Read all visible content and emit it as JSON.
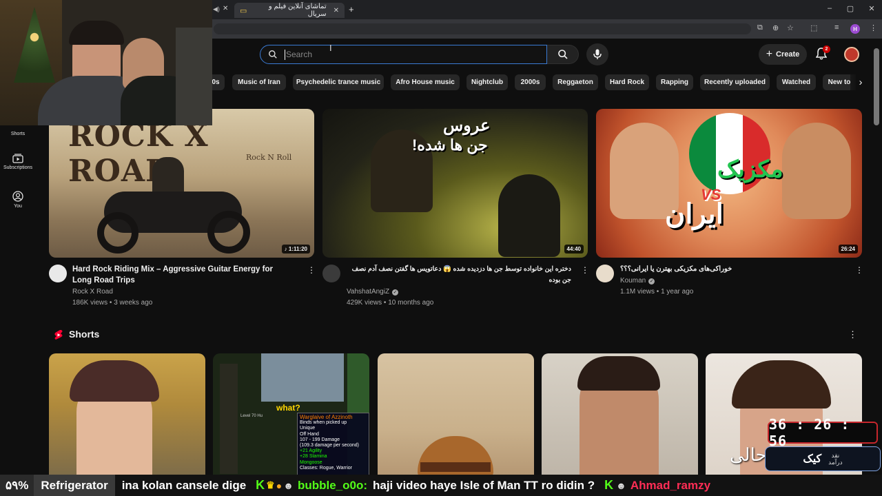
{
  "browser": {
    "tab_title": "تماشای آنلاین فیلم و سریال",
    "new_tab_symbol": "+",
    "window_controls": [
      "–",
      "▢",
      "✕"
    ],
    "profile_letter": "H"
  },
  "header": {
    "search_placeholder": "Search",
    "create_label": "Create",
    "notification_count": "2"
  },
  "chips": [
    "0s",
    "Music of Iran",
    "Psychedelic trance music",
    "Afro House music",
    "Nightclub",
    "2000s",
    "Reggaeton",
    "Hard Rock",
    "Rapping",
    "Recently uploaded",
    "Watched",
    "New to"
  ],
  "sidebar": {
    "items": [
      {
        "label": "Shorts",
        "icon": "shorts-icon"
      },
      {
        "label": "Subscriptions",
        "icon": "subscriptions-icon"
      },
      {
        "label": "You",
        "icon": "you-icon"
      }
    ]
  },
  "videos": [
    {
      "title": "Hard Rock Riding Mix – Aggressive Guitar Energy for Long Road Trips",
      "channel": "Rock X Road",
      "stats": "186K views • 3 weeks ago",
      "duration": "1:11:20",
      "thumb_title": "ROCK X ROAD",
      "thumb_subtitle": "Rock N Roll"
    },
    {
      "title": "دختره این خانواده توسط جن ها دزدیده شده 😱 دعاتویس ها گفتن نصف آدم نصف جن بوده",
      "channel": "VahshatAngiZ",
      "stats": "429K views • 10 months ago",
      "duration": "44:40",
      "thumb_title": "عروس",
      "thumb_subtitle": "جن ها شده!"
    },
    {
      "title": "خوراکی‌های مکزیکی بهترن یا ایرانی؟؟؟",
      "channel": "Kouman",
      "stats": "1.1M views • 1 year ago",
      "duration": "26:24",
      "thumb_title": "مکزیک",
      "thumb_vs": "VS",
      "thumb_subtitle": "ایران"
    }
  ],
  "shorts_section": {
    "title": "Shorts",
    "game_popup": {
      "bubble": "what?",
      "item_name": "Warglaive of Azzinoth",
      "lines": [
        "Binds when picked up",
        "Unique",
        "Off Hand",
        "107 - 199 Damage",
        "(109.3 damage per second)",
        "+21 Agility",
        "+28 Stamina",
        "Mongoose",
        "Classes: Rogue, Warrior"
      ],
      "level": "Level 70 Hu"
    },
    "short5_caption": "حالی"
  },
  "overlay": {
    "timer": "36 : 26 : 56",
    "cake_word": "کیک",
    "cake_line1": "نقد",
    "cake_line2": "درآمد",
    "ticker": {
      "percent": "۵۹%",
      "item": "Refrigerator",
      "msg1": "ina kolan cansele dige",
      "user1": "bubble_o0o:",
      "msg2": "haji video haye Isle of Man TT ro didin ?",
      "user2": "Ahmad_ramzy"
    }
  },
  "colors": {
    "accent_blue": "#3a7bd5",
    "youtube_red": "#ff0033",
    "ticker_green": "#53fc18",
    "ticker_pink": "#ff2d55"
  }
}
